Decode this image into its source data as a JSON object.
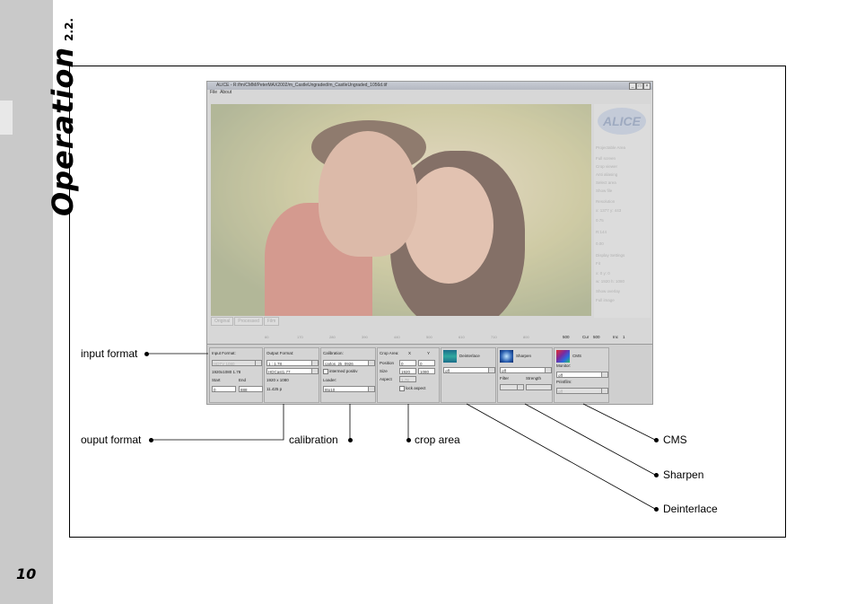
{
  "sidebar": {
    "title": "Operation",
    "section": "2.2.",
    "page_number": "10"
  },
  "app": {
    "title": "ALICE - R:/fm/CMM/PeterMAX2002/m_CastleUngraded/m_CastleUngraded_1056d.tif",
    "menu": [
      "File",
      "About"
    ],
    "logo": "ALICE",
    "right_panel": [
      "Projectable Area",
      "Full screen",
      "Crop viewer",
      "Anti aliasing",
      "Select area",
      "Show file",
      "Resolution",
      "x: 1377 y: 443",
      "0.75",
      "R:144",
      "0.00",
      "Display Settings",
      "Fit",
      "x: 0  y: 0",
      "w: 1920 h: 1080",
      "Show overlay",
      "Full image"
    ],
    "tabs": [
      "Original",
      "Processed",
      "Film"
    ],
    "ruler": [
      "60",
      "170",
      "280",
      "390",
      "440",
      "500",
      "610",
      "710",
      "800"
    ],
    "ruler_right": [
      "500",
      "Cur",
      "500",
      "Inc",
      "1"
    ],
    "panels": {
      "input_format": {
        "label": "Input Format:",
        "value": "HDTV 1080",
        "resolution": "1920x1080 1.78",
        "start_label": "Start",
        "end_label": "End",
        "start": "0",
        "end": "888"
      },
      "output_format": {
        "label": "Output Format:",
        "ratio": "1 : 1.78",
        "preset": "HDCast1.77",
        "resolution": "1920 x 1080",
        "fps": "11.425 p"
      },
      "calibration": {
        "label": "Calibration:",
        "value": "carlos_2k_0926",
        "intermed": "intermed positiv",
        "loader_label": "Loader:",
        "loader": "8to10"
      },
      "crop": {
        "label": "Crop Area:",
        "x_label": "X",
        "y_label": "Y",
        "position_label": "Position",
        "pos_x": "0",
        "pos_y": "0",
        "size_label": "Size",
        "size_x": "1920",
        "size_y": "1080",
        "aspect_label": "Aspect",
        "aspect": "1.78",
        "lock": "lock aspect"
      },
      "deinterlace": {
        "label": "Deinterlace",
        "value": "off"
      },
      "sharpen": {
        "label": "Sharpen",
        "value": "off",
        "filter_label": "Filter",
        "strength_label": "Strength"
      },
      "cms": {
        "label": "CMS",
        "monitor_label": "Monitor:",
        "monitor": "off",
        "printfilm_label": "Printfilm:",
        "printfilm": "off"
      }
    }
  },
  "annotations": {
    "input_format": "input format",
    "output_format": "ouput format",
    "calibration": "calibration",
    "crop_area": "crop area",
    "cms": "CMS",
    "sharpen": "Sharpen",
    "deinterlace": "Deinterlace"
  }
}
